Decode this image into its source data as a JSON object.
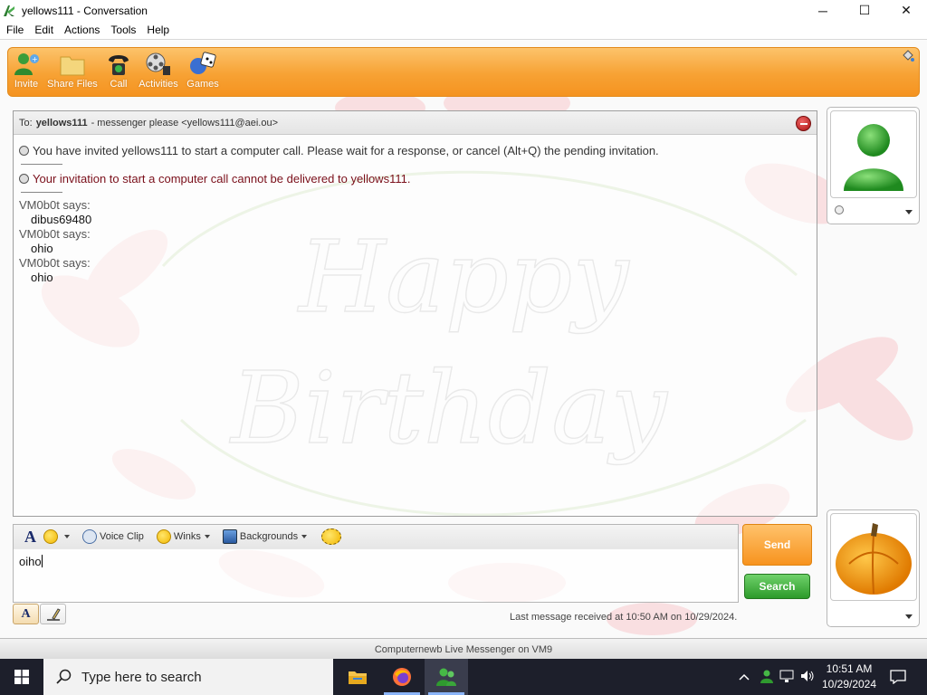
{
  "window": {
    "title": "yellows111 - Conversation",
    "controls": {
      "minimize": "─",
      "maximize": "☐",
      "close": "✕"
    }
  },
  "menu": [
    "File",
    "Edit",
    "Actions",
    "Tools",
    "Help"
  ],
  "toolbar": {
    "items": [
      {
        "label": "Invite",
        "icon": "invite-icon"
      },
      {
        "label": "Share Files",
        "icon": "folder-icon"
      },
      {
        "label": "Call",
        "icon": "phone-icon"
      },
      {
        "label": "Activities",
        "icon": "film-reel-icon"
      },
      {
        "label": "Games",
        "icon": "games-icon"
      }
    ]
  },
  "conversation": {
    "to_label": "To:",
    "to_name": "yellows111",
    "to_detail": "- messenger please <yellows111@aei.ou>",
    "system_messages": [
      "You have invited yellows111 to start a computer call. Please wait for a response, or cancel (Alt+Q) the pending invitation.",
      "Your invitation to start a computer call cannot be delivered to yellows111."
    ],
    "messages": [
      {
        "sender": "VM0b0t says:",
        "text": "dibus69480"
      },
      {
        "sender": "VM0b0t says:",
        "text": "ohio"
      },
      {
        "sender": "VM0b0t says:",
        "text": "ohio"
      }
    ],
    "background_text": [
      "Happy",
      "Birthday"
    ]
  },
  "format_bar": {
    "voice_clip": "Voice Clip",
    "winks": "Winks",
    "backgrounds": "Backgrounds"
  },
  "compose": {
    "value": "oiho"
  },
  "buttons": {
    "send": "Send",
    "search": "Search"
  },
  "status": {
    "last_message": "Last message received at 10:50 AM on 10/29/2024.",
    "footer": "Computernewb Live Messenger on VM9"
  },
  "taskbar": {
    "search_placeholder": "Type here to search",
    "time": "10:51 AM",
    "date": "10/29/2024"
  },
  "colors": {
    "toolbar_orange": "#f7a234",
    "send_orange": "#f7931e",
    "search_green": "#2c9a2a",
    "error_text": "#7a0f1a"
  }
}
